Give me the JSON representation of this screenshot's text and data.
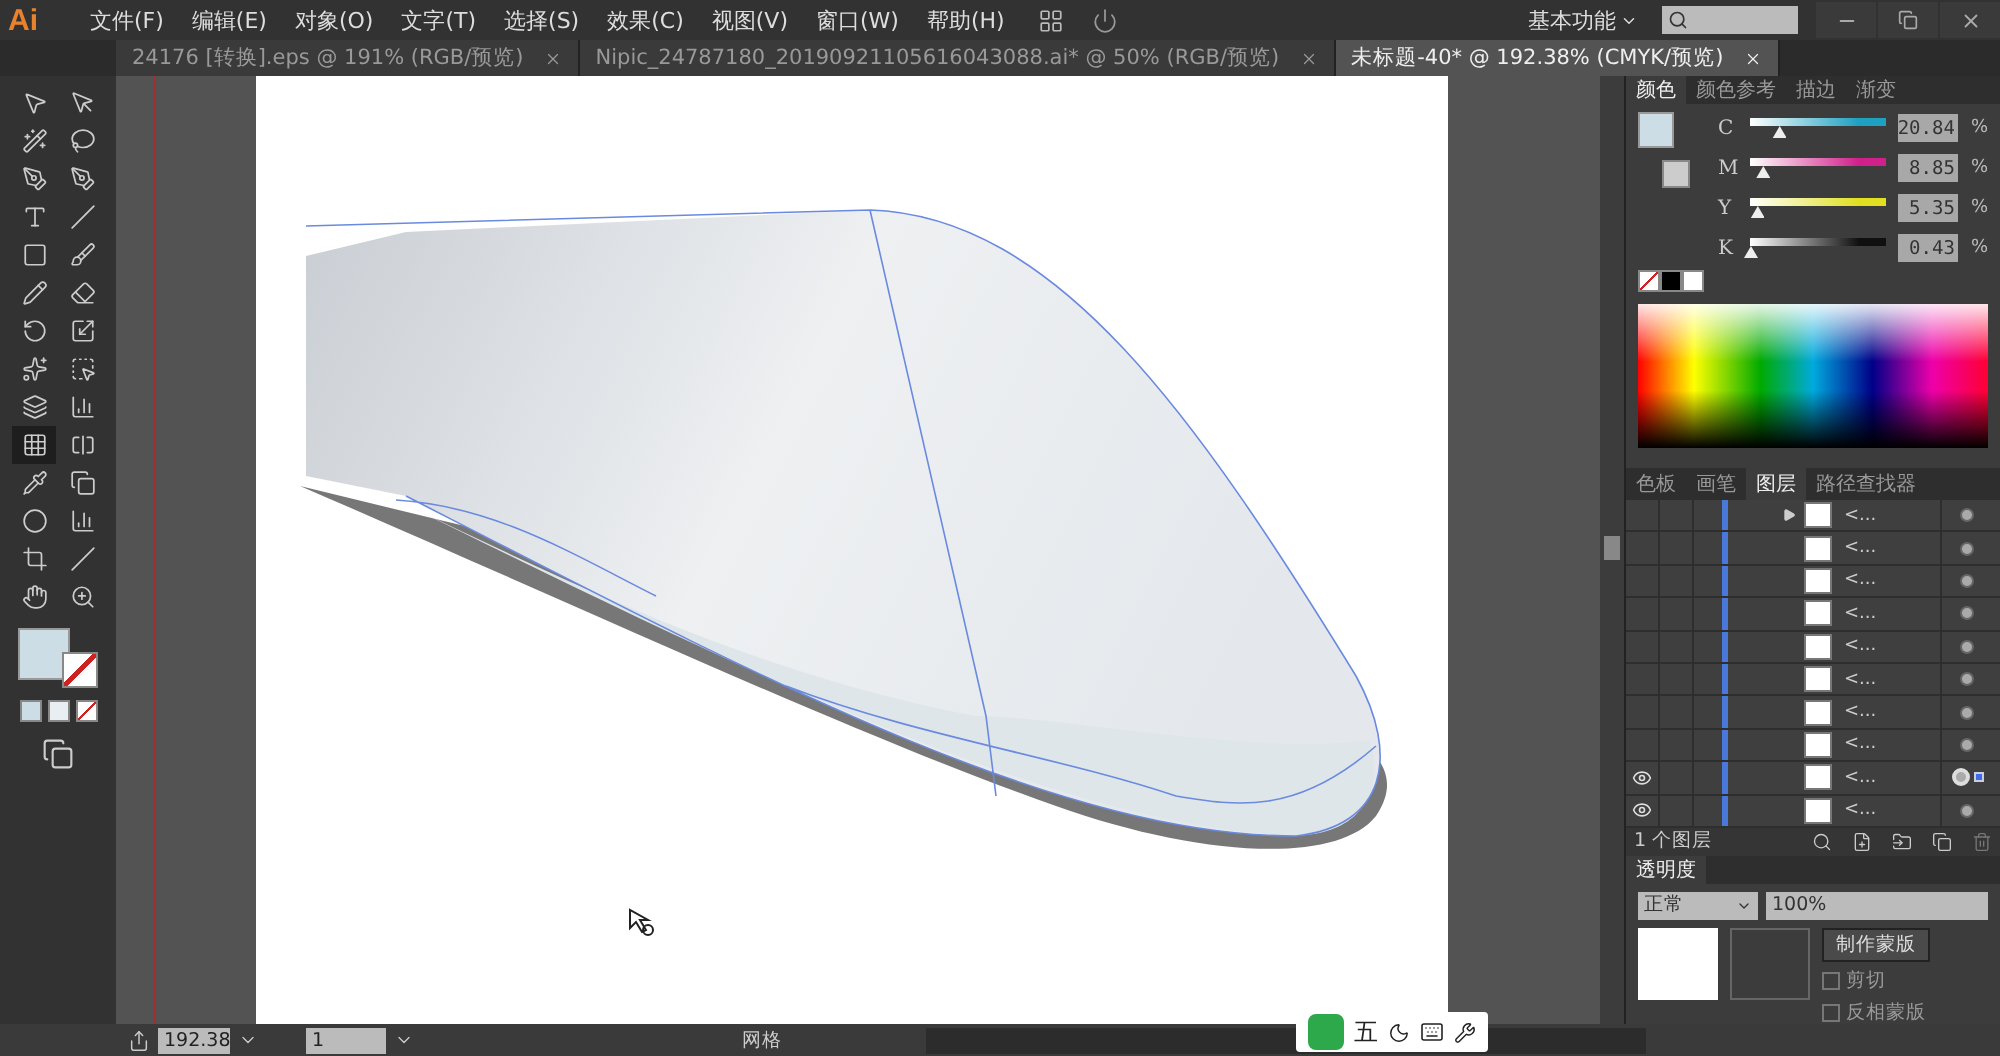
{
  "app": {
    "logo": "Ai"
  },
  "menu": [
    "文件(F)",
    "编辑(E)",
    "对象(O)",
    "文字(T)",
    "选择(S)",
    "效果(C)",
    "视图(V)",
    "窗口(W)",
    "帮助(H)"
  ],
  "workspace": {
    "label": "基本功能"
  },
  "tabs": [
    {
      "label": "24176 [转换].eps @ 191% (RGB/预览)",
      "selected": false
    },
    {
      "label": "Nipic_24787180_20190921105616043088.ai* @ 50% (RGB/预览)",
      "selected": false
    },
    {
      "label": "未标题-40* @ 192.38% (CMYK/预览)",
      "selected": true
    }
  ],
  "color_panel": {
    "tabs": [
      {
        "label": "颜色",
        "selected": true
      },
      {
        "label": "颜色参考",
        "selected": false
      },
      {
        "label": "描边",
        "selected": false
      },
      {
        "label": "渐变",
        "selected": false
      }
    ],
    "sliders": [
      {
        "name": "C",
        "level": 0.21,
        "value": "20.84",
        "unit": "%",
        "color": "#1ea0c0"
      },
      {
        "name": "M",
        "level": 0.09,
        "value": "8.85",
        "unit": "%",
        "color": "#d0208a"
      },
      {
        "name": "Y",
        "level": 0.05,
        "value": "5.35",
        "unit": "%",
        "color": "#e0e020"
      },
      {
        "name": "K",
        "level": 0.0,
        "value": "0.43",
        "unit": "%",
        "color": "#101010"
      }
    ]
  },
  "layers_panel": {
    "tabs": [
      {
        "label": "色板",
        "selected": false
      },
      {
        "label": "画笔",
        "selected": false
      },
      {
        "label": "图层",
        "selected": true
      },
      {
        "label": "路径查找器",
        "selected": false
      }
    ],
    "rows": [
      {
        "label": "<...",
        "visible": false,
        "expandable": true,
        "targeted": false
      },
      {
        "label": "<...",
        "visible": false,
        "expandable": false,
        "targeted": false
      },
      {
        "label": "<...",
        "visible": false,
        "expandable": false,
        "targeted": false
      },
      {
        "label": "<...",
        "visible": false,
        "expandable": false,
        "targeted": false
      },
      {
        "label": "<...",
        "visible": false,
        "expandable": false,
        "targeted": false
      },
      {
        "label": "<...",
        "visible": false,
        "expandable": false,
        "targeted": false
      },
      {
        "label": "<...",
        "visible": false,
        "expandable": false,
        "targeted": false
      },
      {
        "label": "<...",
        "visible": false,
        "expandable": false,
        "targeted": false
      },
      {
        "label": "<...",
        "visible": true,
        "expandable": false,
        "targeted": true
      },
      {
        "label": "<...",
        "visible": true,
        "expandable": false,
        "targeted": false
      }
    ],
    "count": "1 个图层"
  },
  "transparency_panel": {
    "tab": "透明度",
    "mode": "正常",
    "opacity": "100%",
    "mask_button": "制作蒙版",
    "options": [
      {
        "label": "剪切",
        "checked": false
      },
      {
        "label": "反相蒙版",
        "checked": false
      }
    ]
  },
  "status_bar": {
    "zoom": "192.38",
    "page": "1",
    "tool": "网格"
  },
  "ime": {
    "label": "五"
  }
}
